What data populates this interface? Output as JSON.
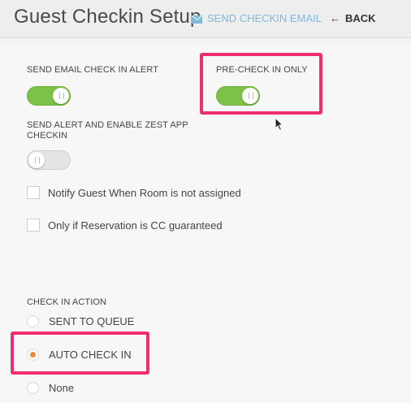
{
  "header": {
    "title": "Guest Checkin Setup",
    "send_email_label": "SEND CHECKIN EMAIL",
    "back_label": "BACK"
  },
  "settings": {
    "send_email_alert": {
      "label": "SEND EMAIL CHECK IN ALERT",
      "enabled": true
    },
    "pre_check_in_only": {
      "label": "PRE-CHECK IN ONLY",
      "enabled": true
    },
    "send_alert_zest": {
      "label_line1": "SEND ALERT AND ENABLE ZEST APP",
      "label_line2": "CHECKIN",
      "enabled": false
    },
    "checkboxes": [
      {
        "label": "Notify Guest When Room is not assigned",
        "checked": false
      },
      {
        "label": "Only if Reservation is CC guaranteed",
        "checked": false
      }
    ]
  },
  "check_in_action": {
    "heading": "CHECK IN ACTION",
    "options": [
      {
        "label": "SENT TO QUEUE",
        "selected": false
      },
      {
        "label": "AUTO CHECK IN",
        "selected": true
      },
      {
        "label": "None",
        "selected": false
      }
    ]
  },
  "colors": {
    "toggle_on": "#7cc249",
    "highlight": "#ee2f6b",
    "radio_selected": "#e8883a",
    "link": "#7fb8d8"
  },
  "icons": [
    "envelope-icon",
    "arrow-left-icon",
    "mouse-cursor-icon"
  ]
}
